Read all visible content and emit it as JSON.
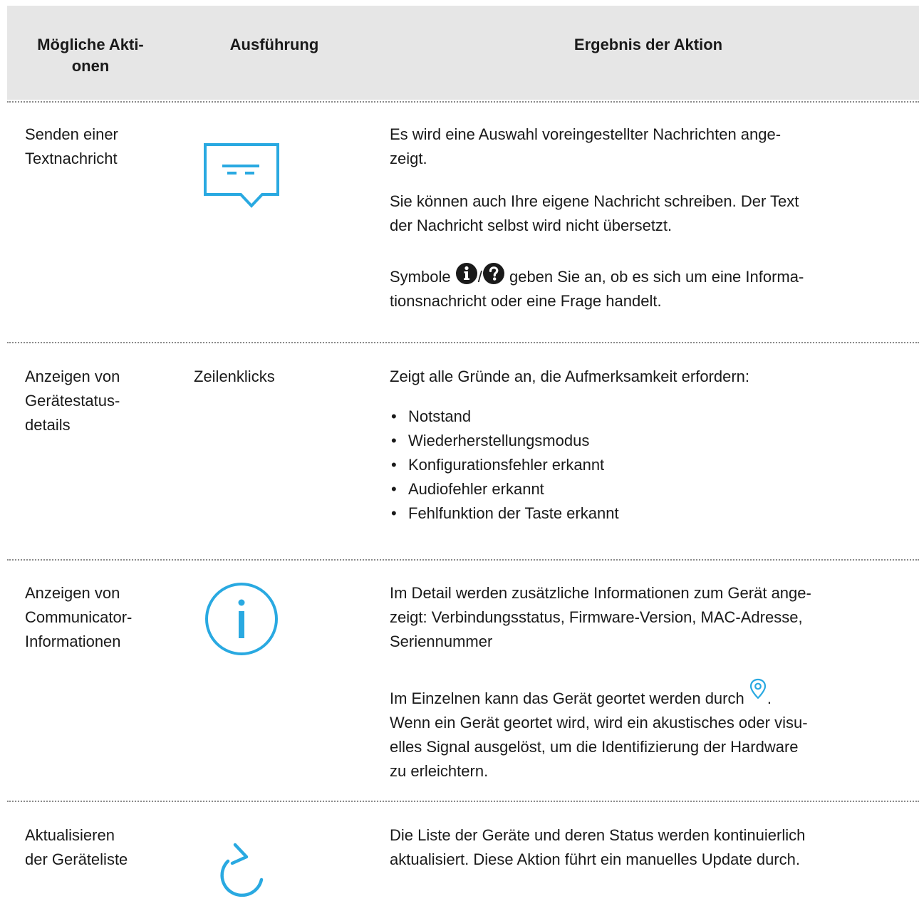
{
  "header": {
    "col_actions": "Mögliche Akti-\nonen",
    "col_execution": "Ausführung",
    "col_result": "Ergebnis der Aktion"
  },
  "rows": [
    {
      "action": "Senden einer Textnachricht",
      "execution_icon": "message-icon",
      "result": [
        "Es wird eine Auswahl voreingestellter Nachrichten ange-zeigt.",
        "Sie können auch Ihre eigene Nachricht schreiben. Der Text der Nachricht selbst wird nicht übersetzt.",
        {
          "before": "Symbole",
          "icons": [
            "info-filled-icon",
            "question-filled-icon"
          ],
          "separator": "/",
          "after": "geben Sie an, ob es sich um eine Informa-tionsnachricht oder eine Frage handelt."
        }
      ]
    },
    {
      "action": "Anzeigen von Gerätestatus-details",
      "execution_text": "Zeilenklicks",
      "result_intro": "Zeigt alle Gründe an, die Aufmerksamkeit erfordern:",
      "result_items": [
        "Notstand",
        "Wiederherstellungsmodus",
        "Konfigurationsfehler erkannt",
        "Audiofehler erkannt",
        "Fehlfunktion der Taste erkannt"
      ]
    },
    {
      "action": "Anzeigen von Communicator-Informationen",
      "execution_icon": "info-circle-icon",
      "result": [
        "Im Detail werden zusätzliche Informationen zum Gerät ange-zeigt: Verbindungsstatus, Firmware-Version, MAC-Adresse, Seriennummer",
        {
          "before": "Im Einzelnen kann das Gerät geortet werden durch",
          "icon": "location-pin-icon",
          "after": ". Wenn ein Gerät geortet wird, wird ein akustisches oder visu-elles Signal ausgelöst, um die Identifizierung der Hardware zu erleichtern."
        }
      ]
    },
    {
      "action": "Aktualisieren der Geräteliste",
      "execution_icon": "refresh-icon",
      "result": [
        "Die Liste der Geräte und deren Status werden kontinuierlich aktualisiert. Diese Aktion führt ein manuelles Update durch."
      ]
    }
  ],
  "text": {
    "h_actions_l1": "Mögliche Akti-",
    "h_actions_l2": "onen",
    "r1_action_l1": "Senden einer",
    "r1_action_l2": "Textnachricht",
    "r1_p1_l1": "Es wird eine Auswahl voreingestellter Nachrichten ange-",
    "r1_p1_l2": "zeigt.",
    "r1_p2_l1": "Sie können auch Ihre eigene Nachricht schreiben. Der Text",
    "r1_p2_l2": "der Nachricht selbst wird nicht übersetzt.",
    "r1_p3_before": "Symbole",
    "r1_p3_sep": "/",
    "r1_p3_after_l1": "geben Sie an, ob es sich um eine Informa-",
    "r1_p3_after_l2": "tionsnachricht oder eine Frage handelt.",
    "r2_action_l1": "Anzeigen von",
    "r2_action_l2": "Gerätestatus-",
    "r2_action_l3": "details",
    "r3_action_l1": "Anzeigen von",
    "r3_action_l2": "Communicator-",
    "r3_action_l3": "Informationen",
    "r3_p1_l1": "Im Detail werden zusätzliche Informationen zum Gerät ange-",
    "r3_p1_l2": "zeigt: Verbindungsstatus, Firmware-Version, MAC-Adresse,",
    "r3_p1_l3": "Seriennummer",
    "r3_p2_before": "Im Einzelnen kann das Gerät geortet werden durch",
    "r3_p2_dot": ".",
    "r3_p2_l2": "Wenn ein Gerät geortet wird, wird ein akustisches oder visu-",
    "r3_p2_l3": "elles Signal ausgelöst, um die Identifizierung der Hardware",
    "r3_p2_l4": "zu erleichtern.",
    "r4_action_l1": "Aktualisieren",
    "r4_action_l2": "der Geräteliste",
    "r4_p1_l1": "Die Liste der Geräte und deren Status werden kontinuierlich",
    "r4_p1_l2": "aktualisiert. Diese Aktion führt ein manuelles Update durch."
  },
  "colors": {
    "accent": "#29a9e1",
    "header_bg": "#e6e6e6",
    "separator": "#8a8a8a",
    "text": "#1a1a1a"
  }
}
